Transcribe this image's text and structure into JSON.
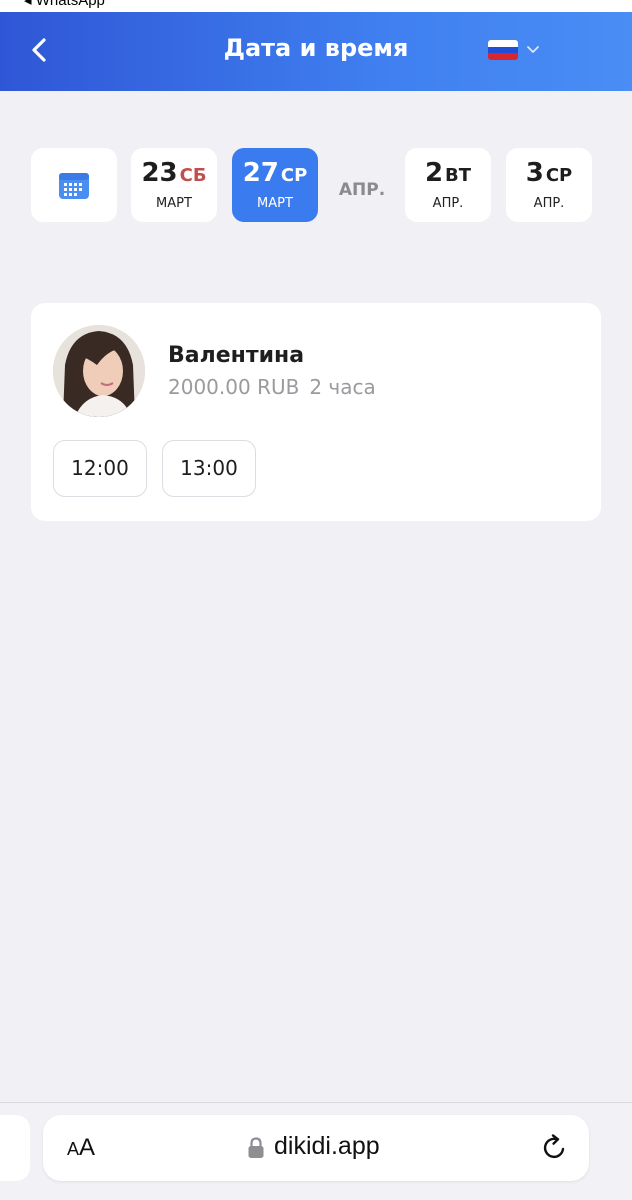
{
  "status": {
    "back_app": "◂ WhatsApp"
  },
  "header": {
    "title": "Дата и время"
  },
  "colors": {
    "accent": "#3a7bf0",
    "header_start": "#2f56d6",
    "header_end": "#4a8df5",
    "weekend": "#c0504d"
  },
  "dates": {
    "items": [
      {
        "num": "23",
        "dow": "СБ",
        "month": "МАРТ",
        "weekend": true,
        "selected": false
      },
      {
        "num": "27",
        "dow": "СР",
        "month": "МАРТ",
        "weekend": false,
        "selected": true
      },
      {
        "num": "2",
        "dow": "ВТ",
        "month": "АПР.",
        "weekend": false,
        "selected": false
      },
      {
        "num": "3",
        "dow": "СР",
        "month": "АПР.",
        "weekend": false,
        "selected": false
      }
    ],
    "month_separator": "АПР."
  },
  "master": {
    "name": "Валентина",
    "price": "2000.00 RUB",
    "duration": "2 часа",
    "slots": [
      "12:00",
      "13:00"
    ]
  },
  "browser": {
    "aa_small": "A",
    "aa_large": "A",
    "url": "dikidi.app"
  },
  "icons": {
    "back": "chevron-left-icon",
    "flag": "russia-flag-icon",
    "dropdown": "chevron-down-icon",
    "calendar": "calendar-icon",
    "lock": "lock-icon",
    "reload": "reload-icon"
  }
}
